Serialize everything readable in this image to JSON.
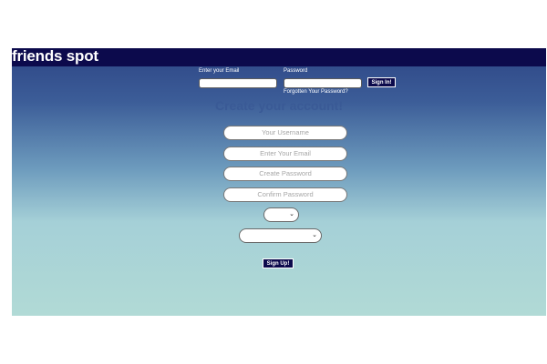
{
  "header": {
    "brand": "friends spot"
  },
  "login": {
    "email_label": "Enter your Email",
    "password_label": "Password",
    "email_value": "",
    "password_value": "",
    "signin_label": "Sign In!",
    "forgot_label": "Forgotten Your Password?"
  },
  "signup": {
    "title": "Create your account!",
    "username_placeholder": "Your Username",
    "email_placeholder": "Enter Your Email",
    "password_placeholder": "Create Password",
    "confirm_placeholder": "Confirm Password",
    "select_small_value": "",
    "select_wide_value": "",
    "signup_label": "Sign Up!"
  },
  "colors": {
    "navbar": "#0c0a4c",
    "gradient_top": "#2d4585",
    "gradient_bottom": "#b1dad6",
    "title": "#3a5a96"
  },
  "icons": {
    "select_arrow": "chevron-down-icon"
  }
}
